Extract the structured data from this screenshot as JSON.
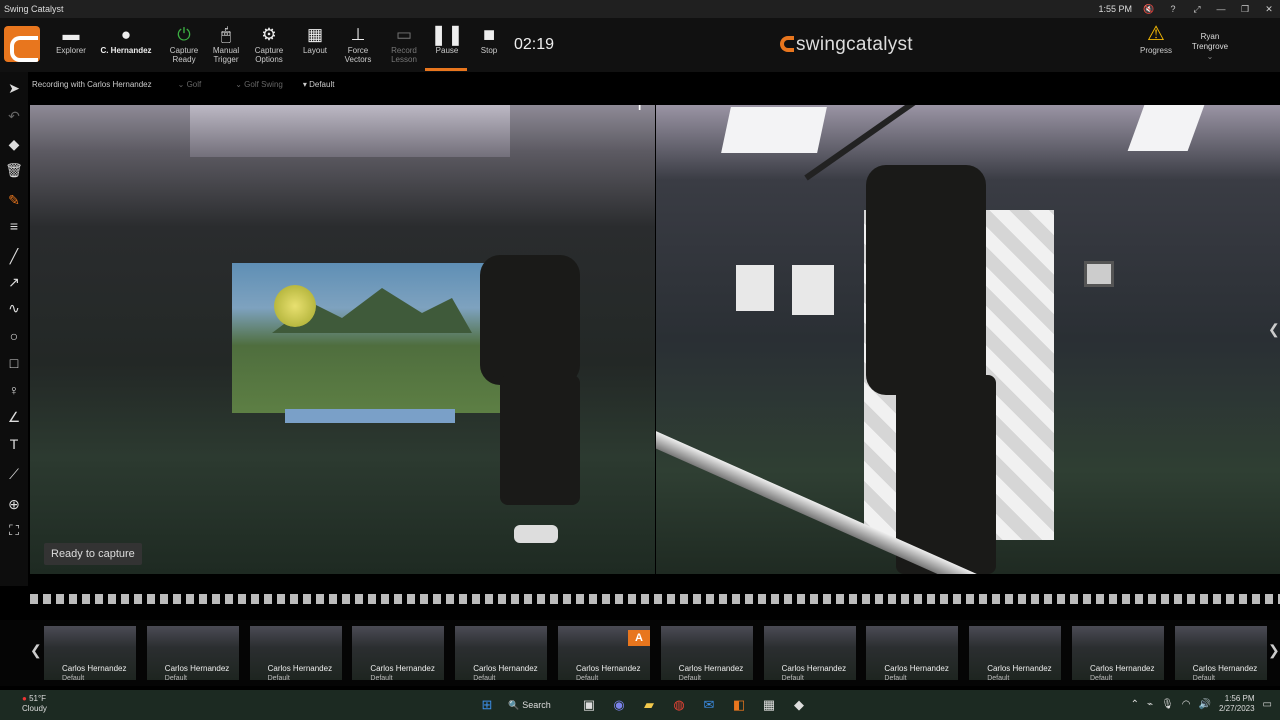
{
  "window": {
    "title": "Swing Catalyst",
    "time": "1:55 PM"
  },
  "toolbar": {
    "explorer": "Explorer",
    "user": "C. Hernandez",
    "capture_ready": [
      "Capture",
      "Ready"
    ],
    "manual_trigger": [
      "Manual",
      "Trigger"
    ],
    "capture_options": [
      "Capture",
      "Options"
    ],
    "layout": "Layout",
    "force_vectors": [
      "Force",
      "Vectors"
    ],
    "record_lesson": [
      "Record",
      "Lesson"
    ],
    "pause": "Pause",
    "stop": "Stop",
    "timer": "02:19",
    "brand": "swingcatalyst",
    "progress": "Progress",
    "account": [
      "Ryan",
      "Trengrove"
    ]
  },
  "subbar": {
    "recording": "Recording with Carlos Hernandez",
    "sport": "Golf",
    "activity": "Golf Swing",
    "preset": "Default"
  },
  "video": {
    "status": "Ready to capture",
    "info_icon": "i"
  },
  "thumbnails": [
    {
      "name": "Carlos Hernandez",
      "preset": "Default"
    },
    {
      "name": "Carlos Hernandez",
      "preset": "Default"
    },
    {
      "name": "Carlos Hernandez",
      "preset": "Default"
    },
    {
      "name": "Carlos Hernandez",
      "preset": "Default"
    },
    {
      "name": "Carlos Hernandez",
      "preset": "Default"
    },
    {
      "name": "Carlos Hernandez",
      "preset": "Default"
    },
    {
      "name": "Carlos Hernandez",
      "preset": "Default"
    },
    {
      "name": "Carlos Hernandez",
      "preset": "Default"
    },
    {
      "name": "Carlos Hernandez",
      "preset": "Default"
    },
    {
      "name": "Carlos Hernandez",
      "preset": "Default"
    },
    {
      "name": "Carlos Hernandez",
      "preset": "Default"
    },
    {
      "name": "Carlos Hernandez",
      "preset": "Default"
    }
  ],
  "thumb_badge": "A",
  "taskbar": {
    "temp": "51°F",
    "condition": "Cloudy",
    "search": "Search",
    "time": "1:56 PM",
    "date": "2/27/2023"
  },
  "colors": {
    "accent": "#e8761e",
    "capture_green": "#3cb043",
    "warning": "#f2b705"
  }
}
